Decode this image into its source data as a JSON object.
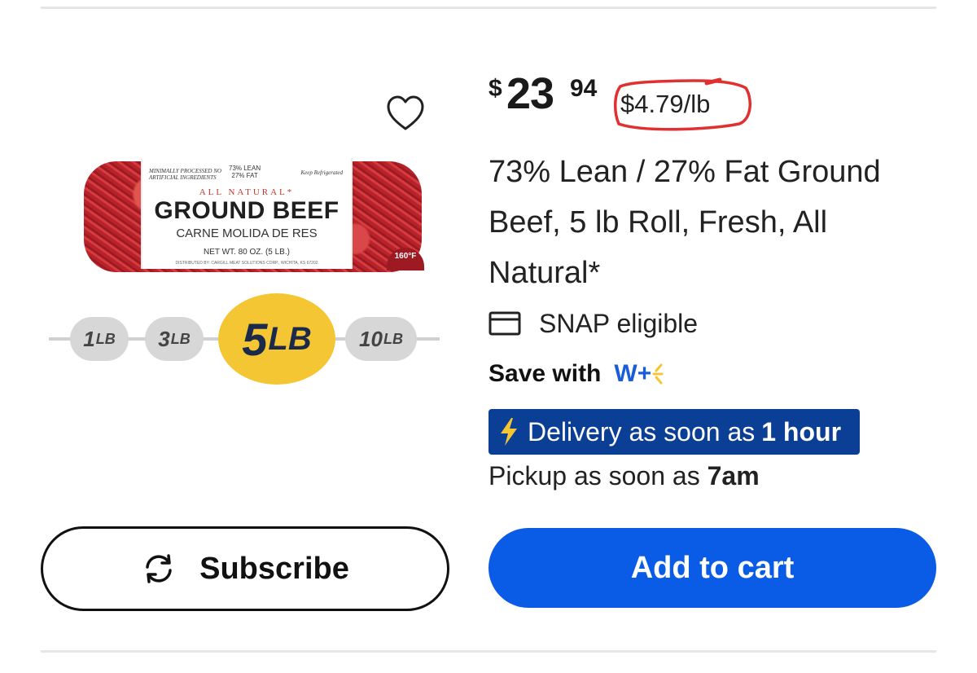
{
  "product": {
    "image": {
      "label_lean": "73% LEAN",
      "label_fat": "27% FAT",
      "label_processed": "MINIMALLY PROCESSED NO ARTIFICIAL INGREDIENTS",
      "label_refrigerated": "Keep Refrigerated",
      "label_natural": "ALL NATURAL*",
      "label_title": "GROUND BEEF",
      "label_spanish": "CARNE MOLIDA DE RES",
      "label_net": "NET WT. 80 OZ. (5 LB.)",
      "label_dist": "DISTRIBUTED BY: CARGILL MEAT SOLUTIONS CORP., WICHITA, KS 67202",
      "label_temp": "160°F"
    },
    "sizes": [
      {
        "num": "1",
        "unit": "LB"
      },
      {
        "num": "3",
        "unit": "LB"
      },
      {
        "num": "5",
        "unit": "LB"
      },
      {
        "num": "10",
        "unit": "LB"
      }
    ],
    "price": {
      "symbol": "$",
      "dollars": "23",
      "cents": "94",
      "unit_price": "$4.79/lb"
    },
    "title": "73% Lean / 27% Fat Ground Beef, 5 lb Roll, Fresh, All Natural*",
    "snap_label": "SNAP eligible",
    "save_label": "Save with",
    "wplus_label": "W+",
    "delivery": {
      "prefix": "Delivery as soon as",
      "time": "1 hour"
    },
    "pickup": {
      "prefix": "Pickup as soon as",
      "time": "7am"
    }
  },
  "actions": {
    "subscribe_label": "Subscribe",
    "add_to_cart_label": "Add to cart"
  },
  "colors": {
    "primary_blue": "#0a5ce6",
    "delivery_bg": "#0b3f96",
    "annotation_red": "#e03030",
    "selected_size": "#f4c633"
  },
  "icons": [
    "heart-icon",
    "card-icon",
    "bolt-icon",
    "refresh-icon",
    "wplus-spark-icon"
  ]
}
